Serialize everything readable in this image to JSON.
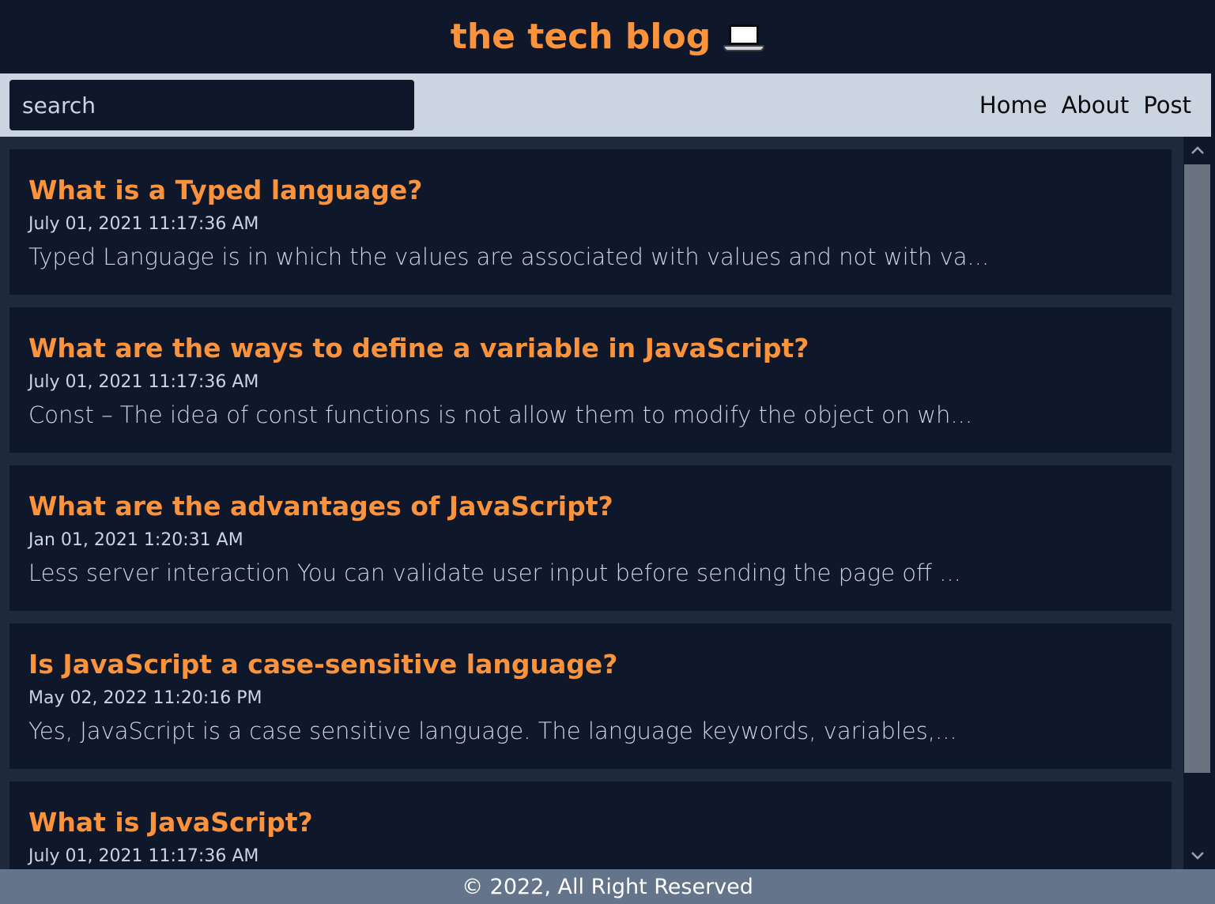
{
  "header": {
    "title": "the tech blog",
    "icon": "laptop-icon"
  },
  "navbar": {
    "search_placeholder": "search",
    "search_value": "",
    "links": [
      {
        "label": "Home"
      },
      {
        "label": "About"
      },
      {
        "label": "Post"
      }
    ]
  },
  "posts": [
    {
      "title": "What is a Typed language?",
      "date": "July 01, 2021 11:17:36 AM",
      "excerpt": "Typed Language is in which the values are associated with values and not with va..."
    },
    {
      "title": "What are the ways to define a variable in JavaScript?",
      "date": "July 01, 2021 11:17:36 AM",
      "excerpt": "Const – The idea of const functions is not allow them to modify the object on wh..."
    },
    {
      "title": "What are the advantages of JavaScript?",
      "date": "Jan 01, 2021 1:20:31 AM",
      "excerpt": "Less server interaction You can validate user input before sending the page off ..."
    },
    {
      "title": "Is JavaScript a case-sensitive language?",
      "date": "May 02, 2022 11:20:16 PM",
      "excerpt": "Yes, JavaScript is a case sensitive language. The language keywords, variables,..."
    },
    {
      "title": "What is JavaScript?",
      "date": "July 01, 2021 11:17:36 AM",
      "excerpt": ""
    }
  ],
  "footer": {
    "text": "© 2022, All Right Reserved"
  },
  "colors": {
    "background": "#0f172a",
    "accent": "#fb923c",
    "navbar": "#cbd5e1",
    "content_bg": "#1e293b",
    "footer": "#64748b"
  }
}
